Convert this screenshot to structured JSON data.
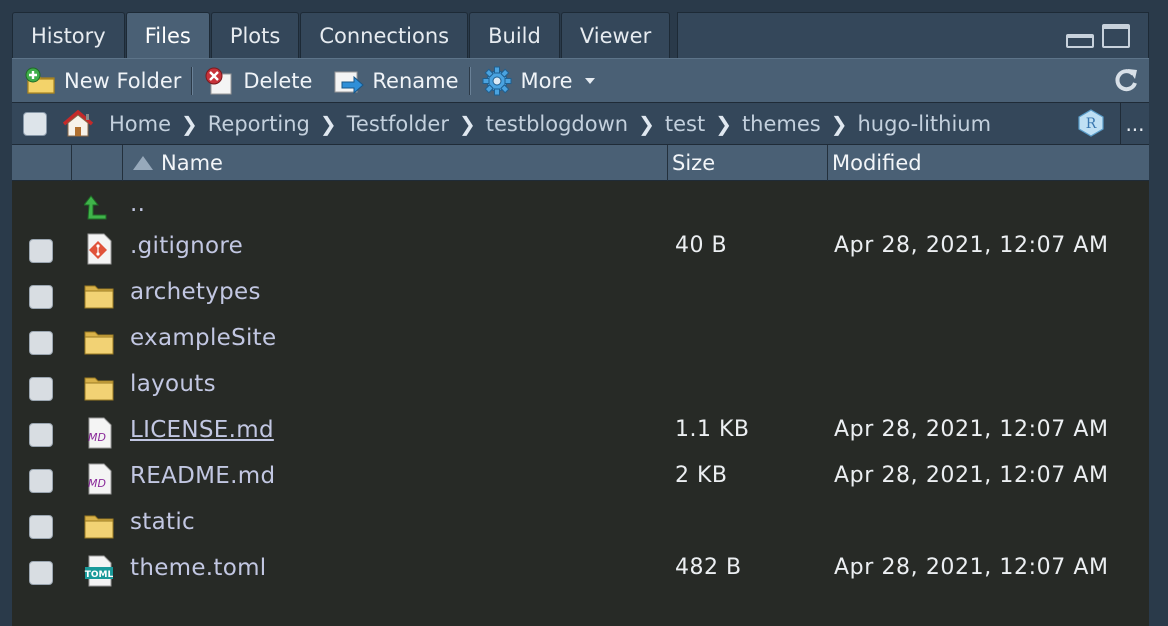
{
  "tabs": [
    {
      "label": "History"
    },
    {
      "label": "Files",
      "active": true
    },
    {
      "label": "Plots"
    },
    {
      "label": "Connections"
    },
    {
      "label": "Build"
    },
    {
      "label": "Viewer"
    }
  ],
  "toolbar": {
    "new_folder": "New Folder",
    "delete": "Delete",
    "rename": "Rename",
    "more": "More"
  },
  "breadcrumb": {
    "items": [
      "Home",
      "Reporting",
      "Testfolder",
      "testblogdown",
      "test",
      "themes",
      "hugo-lithium"
    ],
    "more": "..."
  },
  "columns": {
    "name": "Name",
    "size": "Size",
    "modified": "Modified"
  },
  "files": [
    {
      "name": "..",
      "icon": "parent-up-icon",
      "size": "",
      "modified": ""
    },
    {
      "name": ".gitignore",
      "icon": "git-file-icon",
      "size": "40 B",
      "modified": "Apr 28, 2021, 12:07 AM"
    },
    {
      "name": "archetypes",
      "icon": "folder-icon",
      "size": "",
      "modified": ""
    },
    {
      "name": "exampleSite",
      "icon": "folder-icon",
      "size": "",
      "modified": ""
    },
    {
      "name": "layouts",
      "icon": "folder-icon",
      "size": "",
      "modified": ""
    },
    {
      "name": "LICENSE.md",
      "icon": "markdown-file-icon",
      "size": "1.1 KB",
      "modified": "Apr 28, 2021, 12:07 AM"
    },
    {
      "name": "README.md",
      "icon": "markdown-file-icon",
      "size": "2 KB",
      "modified": "Apr 28, 2021, 12:07 AM"
    },
    {
      "name": "static",
      "icon": "folder-icon",
      "size": "",
      "modified": ""
    },
    {
      "name": "theme.toml",
      "icon": "toml-file-icon",
      "size": "482 B",
      "modified": "Apr 28, 2021, 12:07 AM"
    }
  ]
}
